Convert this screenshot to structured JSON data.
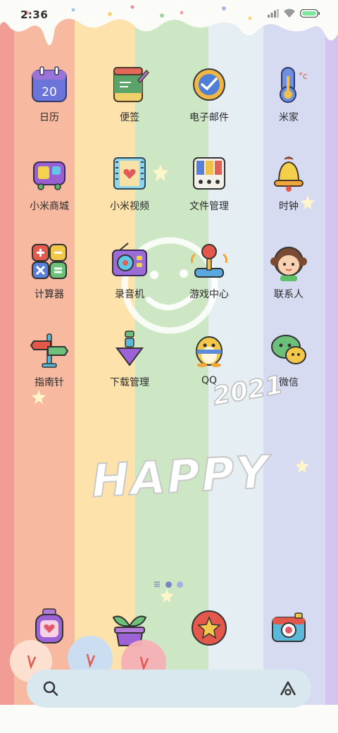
{
  "status_bar": {
    "time": "2:36",
    "icons": [
      "signal-icon",
      "wifi-icon",
      "battery-icon"
    ]
  },
  "wallpaper": {
    "stripes": [
      "#f3a9a1",
      "#fbd3a6",
      "#fde9b8",
      "#cfe7c4",
      "#e3eef3",
      "#d7dcf1",
      "#d6c7ef"
    ],
    "text_happy": "HAPPY",
    "text_year": "2021"
  },
  "apps": [
    {
      "label": "日历",
      "icon": "calendar-icon",
      "date": "20"
    },
    {
      "label": "便签",
      "icon": "notes-icon"
    },
    {
      "label": "电子邮件",
      "icon": "email-icon"
    },
    {
      "label": "米家",
      "icon": "thermometer-icon"
    },
    {
      "label": "小米商城",
      "icon": "shop-icon"
    },
    {
      "label": "小米视频",
      "icon": "video-icon"
    },
    {
      "label": "文件管理",
      "icon": "files-icon"
    },
    {
      "label": "时钟",
      "icon": "bell-icon"
    },
    {
      "label": "计算器",
      "icon": "calculator-icon"
    },
    {
      "label": "录音机",
      "icon": "radio-icon"
    },
    {
      "label": "游戏中心",
      "icon": "joystick-icon"
    },
    {
      "label": "联系人",
      "icon": "girl-icon"
    },
    {
      "label": "指南针",
      "icon": "signpost-icon"
    },
    {
      "label": "下载管理",
      "icon": "download-icon"
    },
    {
      "label": "QQ",
      "icon": "penguin-icon"
    },
    {
      "label": "微信",
      "icon": "chat-bubbles-icon"
    }
  ],
  "dock": [
    {
      "icon": "watch-icon"
    },
    {
      "icon": "plant-icon"
    },
    {
      "icon": "star-icon"
    },
    {
      "icon": "camera-icon"
    }
  ],
  "search": {
    "icon_left": "search-icon",
    "icon_right": "assistant-icon"
  }
}
